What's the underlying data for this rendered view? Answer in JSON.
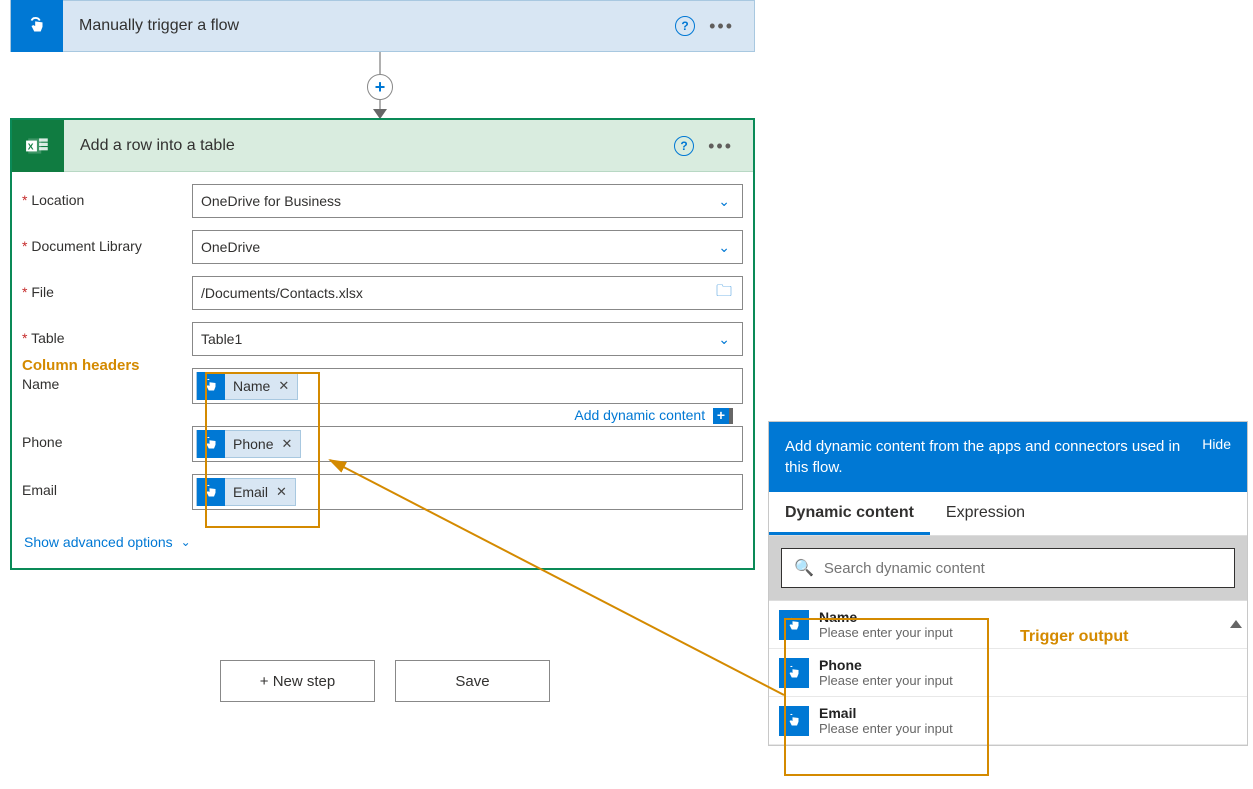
{
  "trigger": {
    "title": "Manually trigger a flow"
  },
  "action": {
    "title": "Add a row into a table",
    "fields": {
      "location": {
        "label": "Location",
        "value": "OneDrive for Business"
      },
      "library": {
        "label": "Document Library",
        "value": "OneDrive"
      },
      "file": {
        "label": "File",
        "value": "/Documents/Contacts.xlsx"
      },
      "table": {
        "label": "Table",
        "value": "Table1"
      },
      "name": {
        "label": "Name",
        "token": "Name"
      },
      "phone": {
        "label": "Phone",
        "token": "Phone"
      },
      "email": {
        "label": "Email",
        "token": "Email"
      }
    },
    "add_dynamic_content": "Add dynamic content",
    "advanced_options": "Show advanced options"
  },
  "buttons": {
    "new_step": "+ New step",
    "save": "Save"
  },
  "dynamic": {
    "header": "Add dynamic content from the apps and connectors used in this flow.",
    "hide": "Hide",
    "tab_dynamic": "Dynamic content",
    "tab_expression": "Expression",
    "search_placeholder": "Search dynamic content",
    "items": [
      {
        "name": "Name",
        "desc": "Please enter your input"
      },
      {
        "name": "Phone",
        "desc": "Please enter your input"
      },
      {
        "name": "Email",
        "desc": "Please enter your input"
      }
    ]
  },
  "annotations": {
    "column_headers": "Column headers",
    "trigger_output": "Trigger output"
  }
}
